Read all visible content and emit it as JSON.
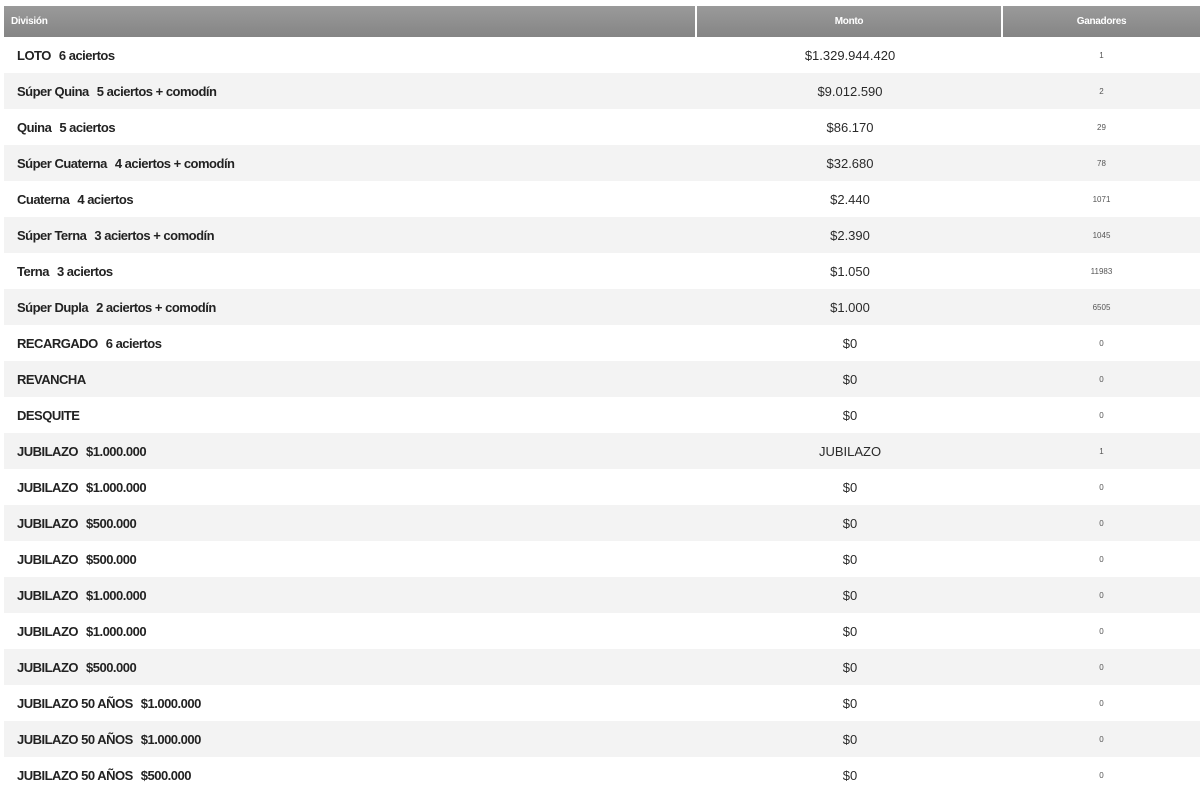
{
  "table": {
    "headers": {
      "division": "División",
      "monto": "Monto",
      "ganadores": "Ganadores"
    },
    "rows": [
      {
        "name": "LOTO",
        "detail": "6 aciertos",
        "monto": "$1.329.944.420",
        "ganadores": "1"
      },
      {
        "name": "Súper Quina",
        "detail": "5 aciertos + comodín",
        "monto": "$9.012.590",
        "ganadores": "2"
      },
      {
        "name": "Quina",
        "detail": "5 aciertos",
        "monto": "$86.170",
        "ganadores": "29"
      },
      {
        "name": "Súper Cuaterna",
        "detail": "4 aciertos + comodín",
        "monto": "$32.680",
        "ganadores": "78"
      },
      {
        "name": "Cuaterna",
        "detail": "4 aciertos",
        "monto": "$2.440",
        "ganadores": "1071"
      },
      {
        "name": "Súper Terna",
        "detail": "3 aciertos + comodín",
        "monto": "$2.390",
        "ganadores": "1045"
      },
      {
        "name": "Terna",
        "detail": "3 aciertos",
        "monto": "$1.050",
        "ganadores": "11983"
      },
      {
        "name": "Súper Dupla",
        "detail": "2 aciertos + comodín",
        "monto": "$1.000",
        "ganadores": "6505"
      },
      {
        "name": "RECARGADO",
        "detail": "6 aciertos",
        "monto": "$0",
        "ganadores": "0"
      },
      {
        "name": "REVANCHA",
        "detail": "",
        "monto": "$0",
        "ganadores": "0"
      },
      {
        "name": "DESQUITE",
        "detail": "",
        "monto": "$0",
        "ganadores": "0"
      },
      {
        "name": "JUBILAZO",
        "detail": "$1.000.000",
        "monto": "JUBILAZO",
        "ganadores": "1"
      },
      {
        "name": "JUBILAZO",
        "detail": "$1.000.000",
        "monto": "$0",
        "ganadores": "0"
      },
      {
        "name": "JUBILAZO",
        "detail": "$500.000",
        "monto": "$0",
        "ganadores": "0"
      },
      {
        "name": "JUBILAZO",
        "detail": "$500.000",
        "monto": "$0",
        "ganadores": "0"
      },
      {
        "name": "JUBILAZO",
        "detail": "$1.000.000",
        "monto": "$0",
        "ganadores": "0"
      },
      {
        "name": "JUBILAZO",
        "detail": "$1.000.000",
        "monto": "$0",
        "ganadores": "0"
      },
      {
        "name": "JUBILAZO",
        "detail": "$500.000",
        "monto": "$0",
        "ganadores": "0"
      },
      {
        "name": "JUBILAZO 50 AÑOS",
        "detail": "$1.000.000",
        "monto": "$0",
        "ganadores": "0"
      },
      {
        "name": "JUBILAZO 50 AÑOS",
        "detail": "$1.000.000",
        "monto": "$0",
        "ganadores": "0"
      },
      {
        "name": "JUBILAZO 50 AÑOS",
        "detail": "$500.000",
        "monto": "$0",
        "ganadores": "0"
      }
    ]
  }
}
